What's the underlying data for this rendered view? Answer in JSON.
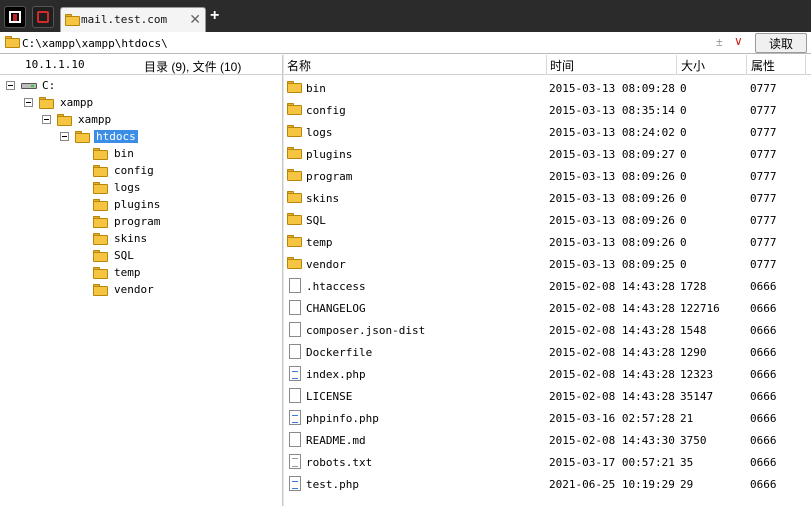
{
  "tab": {
    "title": "mail.test.com",
    "new_tab_symbol": "+",
    "close_symbol": "✕"
  },
  "address": {
    "path": "C:\\xampp\\xampp\\htdocs\\",
    "read_button": "读取"
  },
  "left_panel": {
    "ip": "10.1.1.10",
    "counts": "目录 (9), 文件 (10)",
    "tree": [
      {
        "label": "C:",
        "icon": "drive-icon",
        "depth": 0,
        "expanded": true
      },
      {
        "label": "xampp",
        "icon": "folder-icon",
        "depth": 1,
        "expanded": true
      },
      {
        "label": "xampp",
        "icon": "folder-icon",
        "depth": 2,
        "expanded": true
      },
      {
        "label": "htdocs",
        "icon": "folder-icon",
        "depth": 3,
        "expanded": true,
        "selected": true
      },
      {
        "label": "bin",
        "icon": "folder-icon",
        "depth": 4
      },
      {
        "label": "config",
        "icon": "folder-icon",
        "depth": 4
      },
      {
        "label": "logs",
        "icon": "folder-icon",
        "depth": 4
      },
      {
        "label": "plugins",
        "icon": "folder-icon",
        "depth": 4
      },
      {
        "label": "program",
        "icon": "folder-icon",
        "depth": 4
      },
      {
        "label": "skins",
        "icon": "folder-icon",
        "depth": 4
      },
      {
        "label": "SQL",
        "icon": "folder-icon",
        "depth": 4
      },
      {
        "label": "temp",
        "icon": "folder-icon",
        "depth": 4
      },
      {
        "label": "vendor",
        "icon": "folder-icon",
        "depth": 4
      }
    ]
  },
  "file_list": {
    "columns": [
      "名称",
      "时间",
      "大小",
      "属性"
    ],
    "rows": [
      {
        "name": "bin",
        "type": "folder",
        "time": "2015-03-13 08:09:28",
        "size": "0",
        "attr": "0777"
      },
      {
        "name": "config",
        "type": "folder",
        "time": "2015-03-13 08:35:14",
        "size": "0",
        "attr": "0777"
      },
      {
        "name": "logs",
        "type": "folder",
        "time": "2015-03-13 08:24:02",
        "size": "0",
        "attr": "0777"
      },
      {
        "name": "plugins",
        "type": "folder",
        "time": "2015-03-13 08:09:27",
        "size": "0",
        "attr": "0777"
      },
      {
        "name": "program",
        "type": "folder",
        "time": "2015-03-13 08:09:26",
        "size": "0",
        "attr": "0777"
      },
      {
        "name": "skins",
        "type": "folder",
        "time": "2015-03-13 08:09:26",
        "size": "0",
        "attr": "0777"
      },
      {
        "name": "SQL",
        "type": "folder",
        "time": "2015-03-13 08:09:26",
        "size": "0",
        "attr": "0777"
      },
      {
        "name": "temp",
        "type": "folder",
        "time": "2015-03-13 08:09:26",
        "size": "0",
        "attr": "0777"
      },
      {
        "name": "vendor",
        "type": "folder",
        "time": "2015-03-13 08:09:25",
        "size": "0",
        "attr": "0777"
      },
      {
        "name": ".htaccess",
        "type": "file",
        "time": "2015-02-08 14:43:28",
        "size": "1728",
        "attr": "0666"
      },
      {
        "name": "CHANGELOG",
        "type": "file",
        "time": "2015-02-08 14:43:28",
        "size": "122716",
        "attr": "0666"
      },
      {
        "name": "composer.json-dist",
        "type": "file",
        "time": "2015-02-08 14:43:28",
        "size": "1548",
        "attr": "0666"
      },
      {
        "name": "Dockerfile",
        "type": "file",
        "time": "2015-02-08 14:43:28",
        "size": "1290",
        "attr": "0666"
      },
      {
        "name": "index.php",
        "type": "php",
        "time": "2015-02-08 14:43:28",
        "size": "12323",
        "attr": "0666"
      },
      {
        "name": "LICENSE",
        "type": "file",
        "time": "2015-02-08 14:43:28",
        "size": "35147",
        "attr": "0666"
      },
      {
        "name": "phpinfo.php",
        "type": "php",
        "time": "2015-03-16 02:57:28",
        "size": "21",
        "attr": "0666"
      },
      {
        "name": "README.md",
        "type": "file",
        "time": "2015-02-08 14:43:30",
        "size": "3750",
        "attr": "0666"
      },
      {
        "name": "robots.txt",
        "type": "txt",
        "time": "2015-03-17 00:57:21",
        "size": "35",
        "attr": "0666"
      },
      {
        "name": "test.php",
        "type": "php",
        "time": "2021-06-25 10:19:29",
        "size": "29",
        "attr": "0666"
      }
    ]
  },
  "colors": {
    "tabbar_bg": "#2b2b2b",
    "selection": "#3b8ee6",
    "folder": "#f5c542"
  }
}
